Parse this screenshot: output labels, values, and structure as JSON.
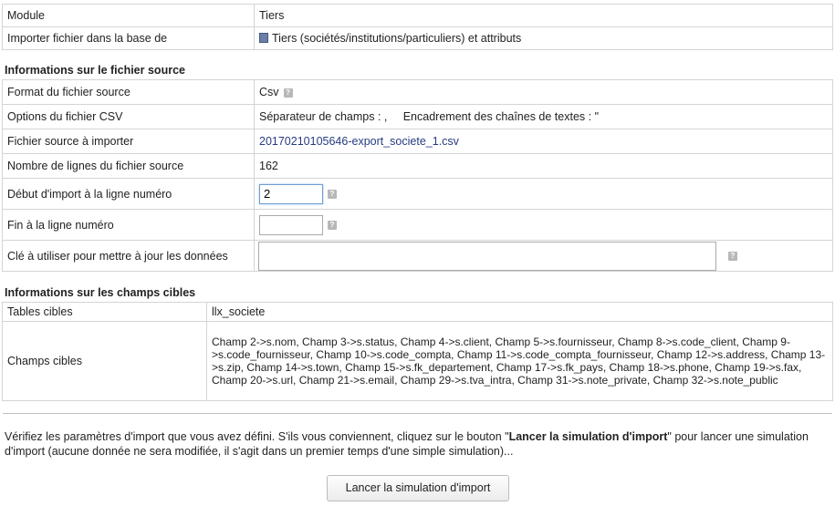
{
  "module_info": {
    "module_label": "Module",
    "module_value": "Tiers",
    "import_label": "Importer fichier dans la base de",
    "import_value": "Tiers (sociétés/institutions/particuliers) et attributs"
  },
  "source_section": {
    "title": "Informations sur le fichier source",
    "format_label": "Format du fichier source",
    "format_value": "Csv",
    "options_label": "Options du fichier CSV",
    "options_value": "Séparateur de champs : ,     Encadrement des chaînes de textes : \"",
    "file_label": "Fichier source à importer",
    "file_value": "20170210105646-export_societe_1.csv",
    "lines_label": "Nombre de lignes du fichier source",
    "lines_value": "162",
    "start_label": "Début d'import à la ligne numéro",
    "start_value": "2",
    "end_label": "Fin à la ligne numéro",
    "end_value": "",
    "key_label": "Clé à utiliser pour mettre à jour les données",
    "key_value": ""
  },
  "target_section": {
    "title": "Informations sur les champs cibles",
    "tables_label": "Tables cibles",
    "tables_value": "llx_societe",
    "fields_label": "Champs cibles",
    "fields_value": "Champ 2->s.nom, Champ 3->s.status, Champ 4->s.client, Champ 5->s.fournisseur, Champ 8->s.code_client, Champ 9->s.code_fournisseur, Champ 10->s.code_compta, Champ 11->s.code_compta_fournisseur, Champ 12->s.address, Champ 13->s.zip, Champ 14->s.town, Champ 15->s.fk_departement, Champ 17->s.fk_pays, Champ 18->s.phone, Champ 19->s.fax, Champ 20->s.url, Champ 21->s.email, Champ 29->s.tva_intra, Champ 31->s.note_private, Champ 32->s.note_public"
  },
  "footer": {
    "text_before": "Vérifiez les paramètres d'import que vous avez défini. S'ils vous conviennent, cliquez sur le bouton \"",
    "text_bold": "Lancer la simulation d'import",
    "text_after": "\" pour lancer une simulation d'import (aucune donnée ne sera modifiée, il s'agit dans un premier temps d'une simple simulation)...",
    "button_label": "Lancer la simulation d'import"
  },
  "icons": {
    "help": "help-icon",
    "book": "book-icon"
  }
}
